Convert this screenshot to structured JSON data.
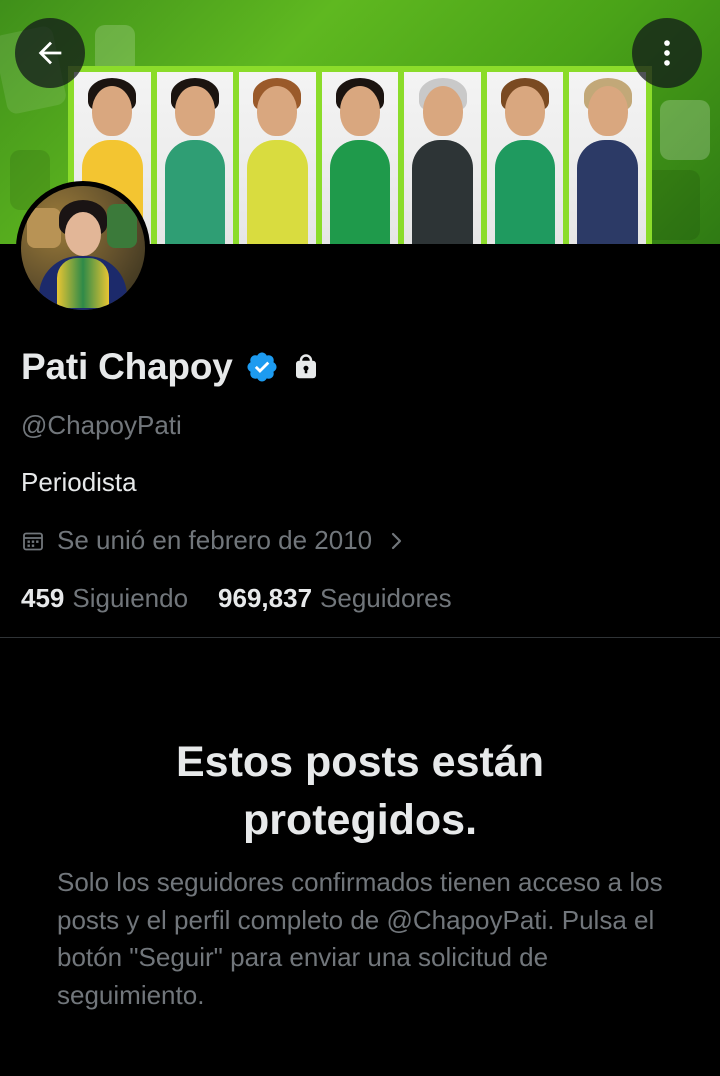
{
  "profile": {
    "display_name": "Pati Chapoy",
    "handle": "@ChapoyPati",
    "bio": "Periodista",
    "joined": "Se unió en febrero de 2010"
  },
  "stats": {
    "following_count": "459",
    "following_label": "Siguiendo",
    "followers_count": "969,837",
    "followers_label": "Seguidores"
  },
  "protected": {
    "title": "Estos posts están protegidos.",
    "description": "Solo los seguidores confirmados tienen acceso a los posts y el perfil completo de @ChapoyPati. Pulsa el botón \"Seguir\" para enviar una solicitud de seguimiento."
  },
  "icons": {
    "back": "arrow-left-icon",
    "more": "more-vertical-icon",
    "verified": "verified-badge-icon",
    "protected": "lock-icon",
    "joined": "calendar-icon",
    "joined_more": "chevron-right-icon"
  },
  "colors": {
    "background": "#000000",
    "primary_text": "#e7e9ea",
    "secondary_text": "#71767b",
    "verified_blue": "#1d9bf0",
    "banner_green": "#5fb820",
    "divider": "#2f3336"
  },
  "banner": {
    "people": [
      {
        "top": "#f3c531",
        "hair": "#1b1410"
      },
      {
        "top": "#2f9e74",
        "hair": "#1b1410"
      },
      {
        "top": "#d9dc3f",
        "hair": "#9a5a2a"
      },
      {
        "top": "#1f9a4b",
        "hair": "#1b1410"
      },
      {
        "top": "#2d3436",
        "hair": "#c9c9c9"
      },
      {
        "top": "#1f9a5f",
        "hair": "#7a4a22"
      },
      {
        "top": "#2c3a66",
        "hair": "#c2a878"
      }
    ]
  }
}
